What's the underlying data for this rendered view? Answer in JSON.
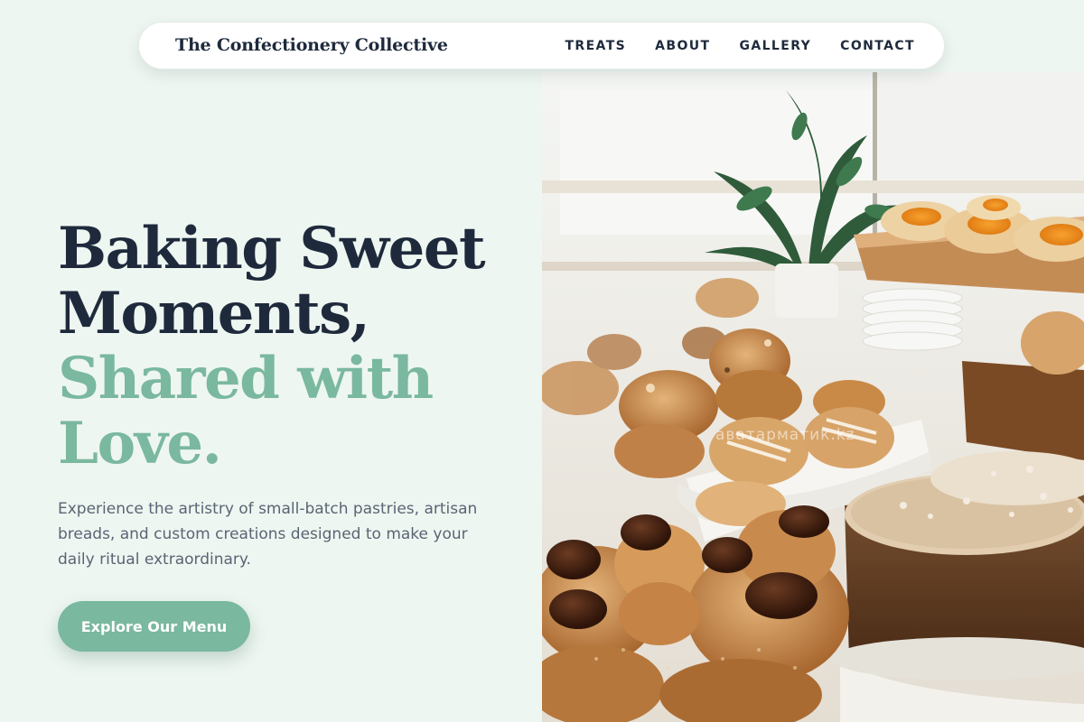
{
  "header": {
    "brand": "The Confectionery Collective",
    "nav": [
      {
        "label": "TREATS"
      },
      {
        "label": "ABOUT"
      },
      {
        "label": "GALLERY"
      },
      {
        "label": "CONTACT"
      }
    ]
  },
  "hero": {
    "headline_line1": "Baking Sweet",
    "headline_line2": "Moments,",
    "headline_line3": "Shared with",
    "headline_line4": "Love.",
    "description": "Experience the artistry of small-batch pastries, artisan breads, and custom creations designed to make your daily ritual extraordinary.",
    "cta_label": "Explore Our Menu",
    "photo_watermark": "аватарматик.kz"
  },
  "colors": {
    "background": "#eef6f1",
    "heading_dark": "#1e2a3c",
    "accent_green": "#7ab8a0",
    "body_text": "#5b6474"
  }
}
